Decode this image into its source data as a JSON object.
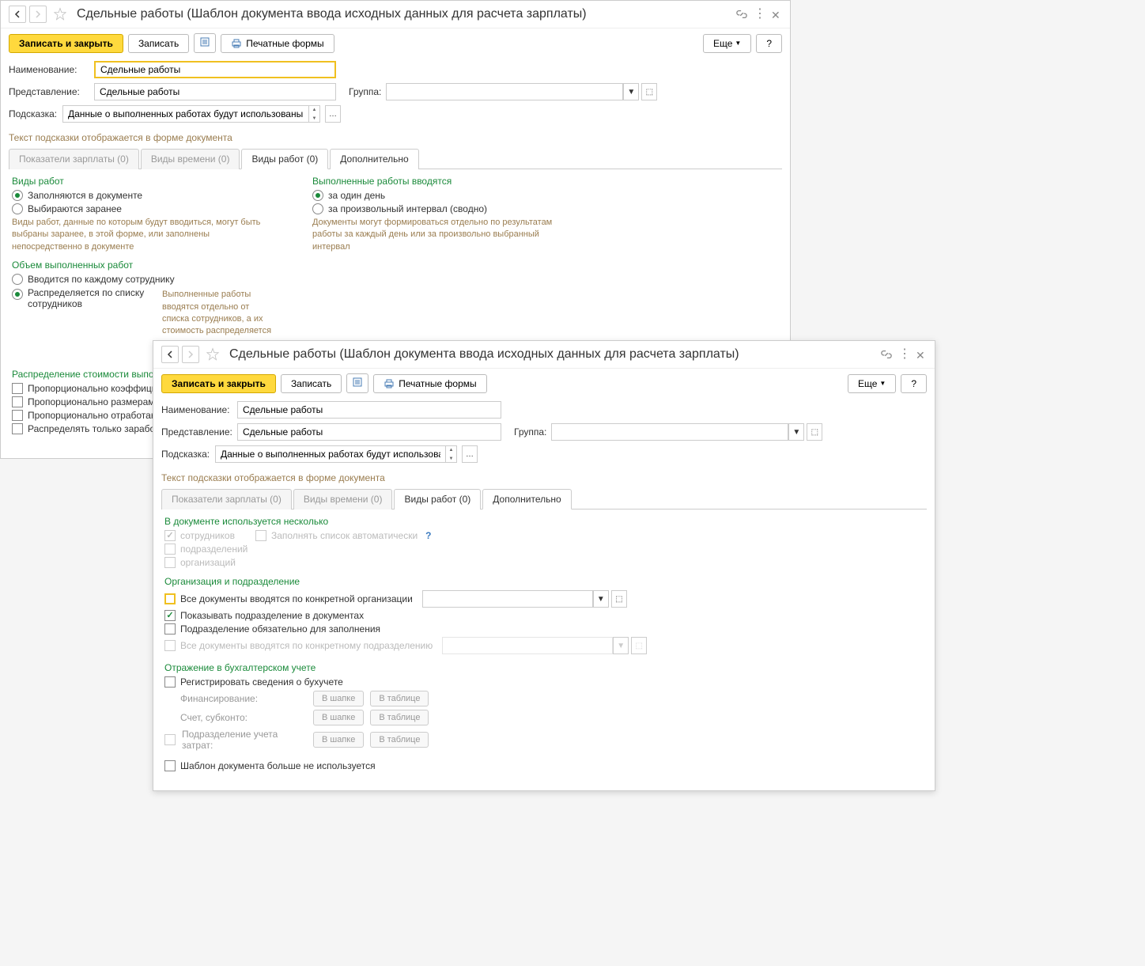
{
  "title": "Сдельные работы (Шаблон документа ввода исходных данных для расчета зарплаты)",
  "toolbar": {
    "save_close": "Записать и закрыть",
    "save": "Записать",
    "print": "Печатные формы",
    "more": "Еще",
    "help": "?"
  },
  "form": {
    "name_label": "Наименование:",
    "name_value": "Сдельные работы",
    "repr_label": "Представление:",
    "repr_value": "Сдельные работы",
    "group_label": "Группа:",
    "hint_label": "Подсказка:",
    "hint_value": "Данные о выполненных работах будут использованы при",
    "hint_note": "Текст подсказки отображается в форме документа"
  },
  "tabs": {
    "t1": "Показатели зарплаты (0)",
    "t2": "Виды времени (0)",
    "t3": "Виды работ (0)",
    "t4": "Дополнительно"
  },
  "tab3": {
    "s1_title": "Виды работ",
    "s1_r1": "Заполняются в документе",
    "s1_r2": "Выбираются заранее",
    "s1_hint": "Виды работ, данные по которым будут вводиться, могут быть выбраны заранее, в этой форме, или заполнены непосредственно в документе",
    "s2_title": "Объем выполненных работ",
    "s2_r1": "Вводится по каждому сотруднику",
    "s2_r2": "Распределяется по списку сотрудников",
    "s2_hint": "Выполненные работы вводятся отдельно от списка сотрудников, а их стоимость распределяется пропорционально среди сотрудников",
    "s3_title": "Выполненные работы вводятся",
    "s3_r1": "за один день",
    "s3_r2": "за произвольный интервал (сводно)",
    "s3_hint": "Документы могут формироваться отдельно по результатам работы за каждый день или за произвольно выбранный интервал",
    "s4_title": "Распределение стоимости выполне",
    "s4_c1": "Пропорционально коэффициент",
    "s4_c2": "Пропорционально размерам та",
    "s4_c3": "Пропорционально отработанном",
    "s4_c4": "Распределять только заработо"
  },
  "tab4": {
    "s1_title": "В документе используется несколько",
    "c_employees": "сотрудников",
    "c_autofill": "Заполнять список автоматически",
    "c_depts": "подразделений",
    "c_orgs": "организаций",
    "s2_title": "Организация и подразделение",
    "c_by_org": "Все документы вводятся по конкретной организации",
    "c_show_dept": "Показывать подразделение в документах",
    "c_dept_req": "Подразделение обязательно для заполнения",
    "c_by_dept": "Все документы вводятся по конкретному подразделению",
    "s3_title": "Отражение в бухгалтерском учете",
    "c_reg": "Регистрировать сведения о бухучете",
    "l_fin": "Финансирование:",
    "l_acc": "Счет, субконто:",
    "c_dept_cost": "Подразделение учета затрат:",
    "b_head": "В шапке",
    "b_table": "В таблице",
    "c_noused": "Шаблон документа больше не используется"
  }
}
